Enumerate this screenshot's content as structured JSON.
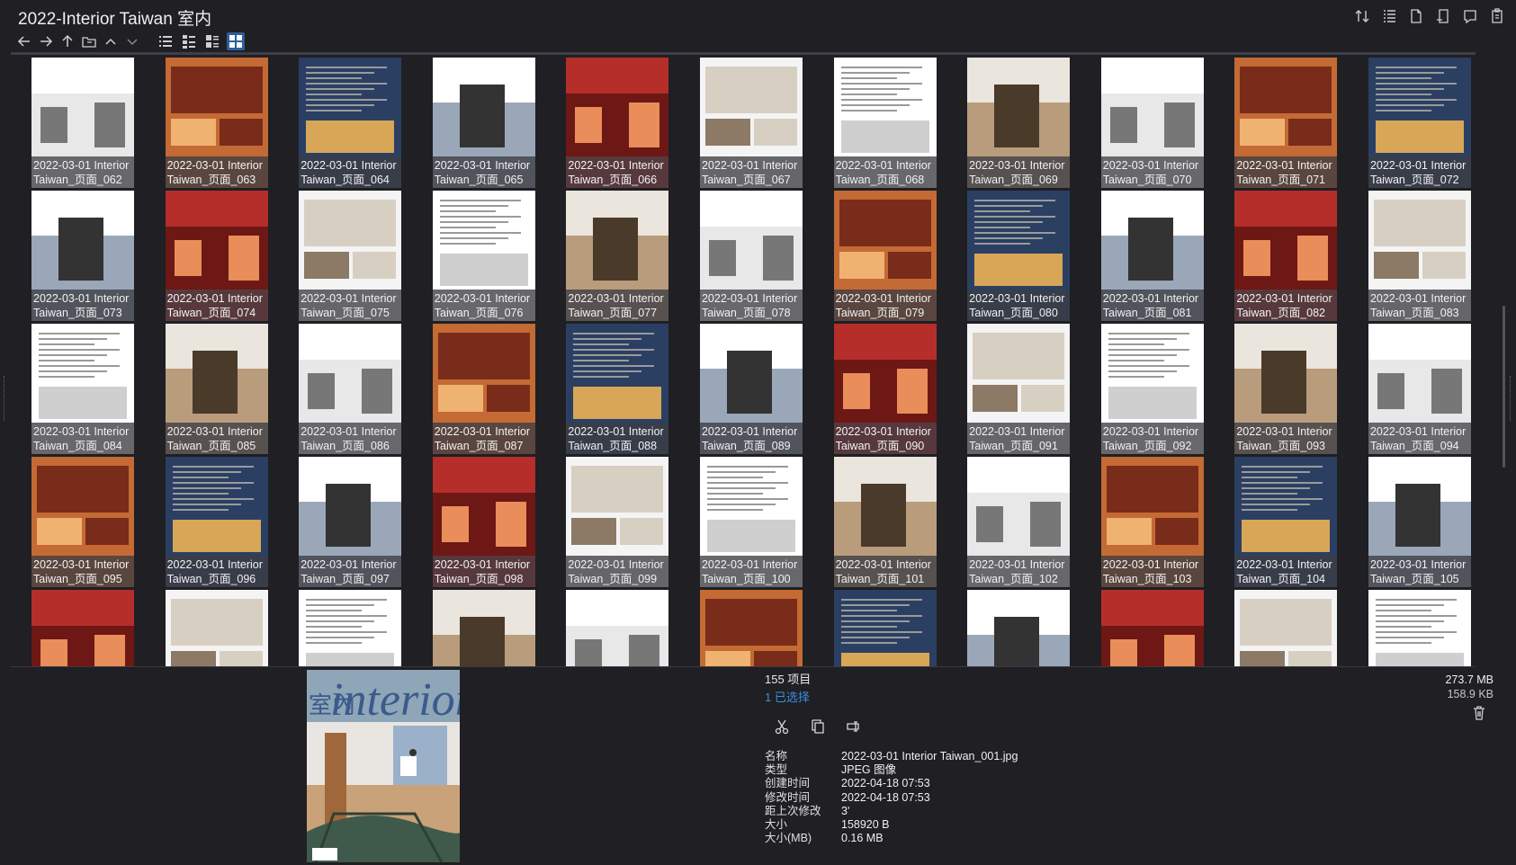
{
  "window": {
    "title": "2022-Interior Taiwan 室内"
  },
  "toolbar_icons": [
    "sort-icon",
    "detail-list-icon",
    "file-icon",
    "new-file-icon",
    "tag-icon",
    "paste-icon"
  ],
  "nav_icons": [
    "back-arrow-icon",
    "forward-arrow-icon",
    "up-arrow-icon",
    "folder-icon",
    "chevron-up-icon",
    "chevron-down-icon"
  ],
  "view_modes": [
    "list-view-icon",
    "details-view-icon",
    "tiles-view-icon",
    "thumbnail-view-icon"
  ],
  "active_view": "thumbnail-view-icon",
  "grid": {
    "rows": [
      [
        "2022-03-01 Interior\nTaiwan_页面_062",
        "2022-03-01 Interior\nTaiwan_页面_063",
        "2022-03-01 Interior\nTaiwan_页面_064",
        "2022-03-01 Interior\nTaiwan_页面_065",
        "2022-03-01 Interior\nTaiwan_页面_066",
        "2022-03-01 Interior\nTaiwan_页面_067",
        "2022-03-01 Interior\nTaiwan_页面_068",
        "2022-03-01 Interior\nTaiwan_页面_069",
        "2022-03-01 Interior\nTaiwan_页面_070",
        "2022-03-01 Interior\nTaiwan_页面_071",
        "2022-03-01 Interior\nTaiwan_页面_072"
      ],
      [
        "2022-03-01 Interior\nTaiwan_页面_073",
        "2022-03-01 Interior\nTaiwan_页面_074",
        "2022-03-01 Interior\nTaiwan_页面_075",
        "2022-03-01 Interior\nTaiwan_页面_076",
        "2022-03-01 Interior\nTaiwan_页面_077",
        "2022-03-01 Interior\nTaiwan_页面_078",
        "2022-03-01 Interior\nTaiwan_页面_079",
        "2022-03-01 Interior\nTaiwan_页面_080",
        "2022-03-01 Interior\nTaiwan_页面_081",
        "2022-03-01 Interior\nTaiwan_页面_082",
        "2022-03-01 Interior\nTaiwan_页面_083"
      ],
      [
        "2022-03-01 Interior\nTaiwan_页面_084",
        "2022-03-01 Interior\nTaiwan_页面_085",
        "2022-03-01 Interior\nTaiwan_页面_086",
        "2022-03-01 Interior\nTaiwan_页面_087",
        "2022-03-01 Interior\nTaiwan_页面_088",
        "2022-03-01 Interior\nTaiwan_页面_089",
        "2022-03-01 Interior\nTaiwan_页面_090",
        "2022-03-01 Interior\nTaiwan_页面_091",
        "2022-03-01 Interior\nTaiwan_页面_092",
        "2022-03-01 Interior\nTaiwan_页面_093",
        "2022-03-01 Interior\nTaiwan_页面_094"
      ],
      [
        "2022-03-01 Interior\nTaiwan_页面_095",
        "2022-03-01 Interior\nTaiwan_页面_096",
        "2022-03-01 Interior\nTaiwan_页面_097",
        "2022-03-01 Interior\nTaiwan_页面_098",
        "2022-03-01 Interior\nTaiwan_页面_099",
        "2022-03-01 Interior\nTaiwan_页面_100",
        "2022-03-01 Interior\nTaiwan_页面_101",
        "2022-03-01 Interior\nTaiwan_页面_102",
        "2022-03-01 Interior\nTaiwan_页面_103",
        "2022-03-01 Interior\nTaiwan_页面_104",
        "2022-03-01 Interior\nTaiwan_页面_105"
      ]
    ],
    "partial_row_count": 11
  },
  "status": {
    "item_count": "155 项目",
    "selected_count": "1 已选择",
    "total_size": "273.7 MB",
    "selected_size": "158.9 KB"
  },
  "preview": {
    "brand_text": "interior",
    "brand_cn": "室內"
  },
  "actions": [
    "cut-icon",
    "copy-icon",
    "rename-icon"
  ],
  "properties": [
    {
      "key": "名称",
      "value": "2022-03-01 Interior Taiwan_001.jpg"
    },
    {
      "key": "类型",
      "value": "JPEG 图像"
    },
    {
      "key": "创建时间",
      "value": "2022-04-18  07:53"
    },
    {
      "key": "修改时间",
      "value": "2022-04-18  07:53"
    },
    {
      "key": "距上次修改",
      "value": "3'"
    },
    {
      "key": "大小",
      "value": "158920 B"
    },
    {
      "key": "大小(MB)",
      "value": "0.16 MB"
    }
  ],
  "colors": {
    "background": "#1f1f24",
    "accent": "#2c5f9e",
    "selected_text": "#3b8fe0"
  }
}
